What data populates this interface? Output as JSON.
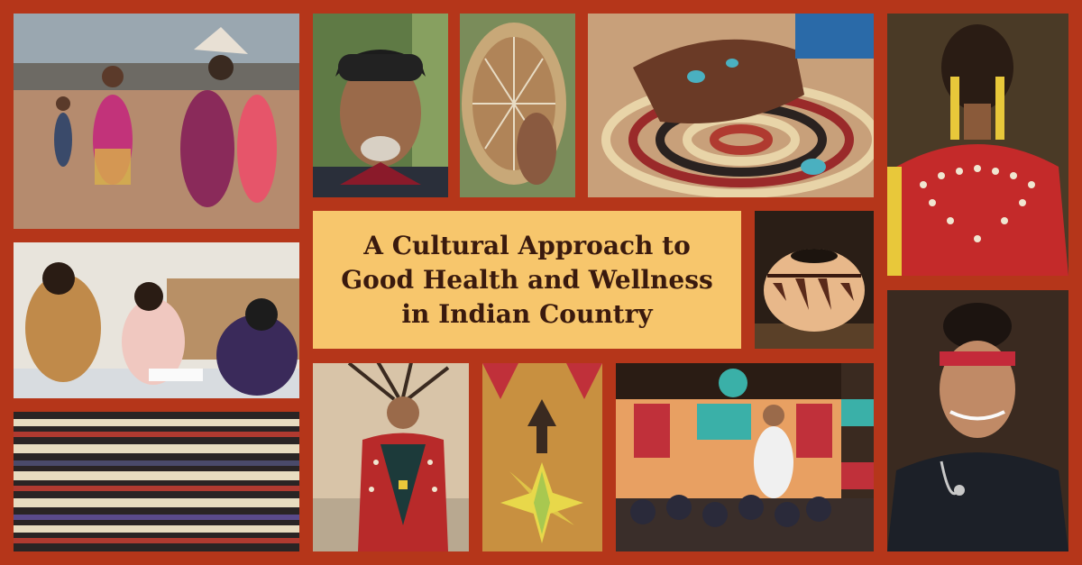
{
  "title": {
    "line1": "A Cultural Approach to",
    "line2": "Good Health and Wellness",
    "line3": "in Indian Country"
  },
  "colors": {
    "frame": "#b5361a",
    "title_panel": "#f7c66c",
    "title_text": "#3a1a0e"
  },
  "photos": [
    "powwow-dancers-photo",
    "elder-portrait-photo",
    "hand-drum-photo",
    "basket-weaving-hands-photo",
    "braided-hair-regalia-photo",
    "classroom-photo",
    "pottery-bowl-photo",
    "nurse-portrait-photo",
    "woven-textile-photo",
    "feather-regalia-dancer-photo",
    "beadwork-pattern-photo",
    "totem-longhouse-photo"
  ]
}
